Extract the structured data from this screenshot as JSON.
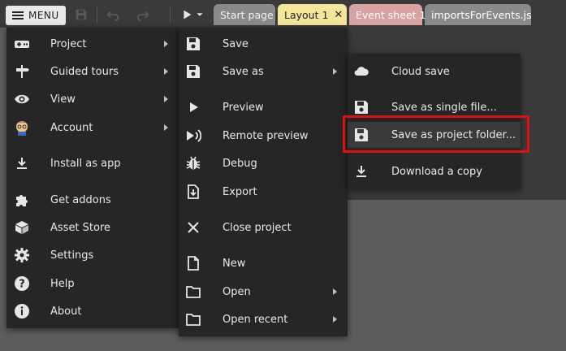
{
  "toolbar": {
    "menu_label": "MENU",
    "tabs": [
      {
        "label": "Start page"
      },
      {
        "label": "Layout 1",
        "close": "✕"
      },
      {
        "label": "Event sheet 1"
      },
      {
        "label": "importsForEvents.js"
      }
    ]
  },
  "main_menu": {
    "items": [
      {
        "label": "Project",
        "icon": "gamepad-icon",
        "submenu": true
      },
      {
        "label": "Guided tours",
        "icon": "signpost-icon",
        "submenu": true
      },
      {
        "label": "View",
        "icon": "eye-icon",
        "submenu": true
      },
      {
        "label": "Account",
        "icon": "avatar-icon",
        "submenu": true
      },
      {
        "label": "Install as app",
        "icon": "download-icon"
      },
      {
        "label": "Get addons",
        "icon": "puzzle-icon"
      },
      {
        "label": "Asset Store",
        "icon": "box-icon"
      },
      {
        "label": "Settings",
        "icon": "gear-icon"
      },
      {
        "label": "Help",
        "icon": "help-icon"
      },
      {
        "label": "About",
        "icon": "info-icon"
      }
    ]
  },
  "project_menu": {
    "items": [
      {
        "label": "Save",
        "icon": "floppy-icon"
      },
      {
        "label": "Save as",
        "icon": "floppy-icon",
        "submenu": true
      },
      {
        "label": "Preview",
        "icon": "play-icon"
      },
      {
        "label": "Remote preview",
        "icon": "remote-preview-icon"
      },
      {
        "label": "Debug",
        "icon": "bug-icon"
      },
      {
        "label": "Export",
        "icon": "export-icon"
      },
      {
        "label": "Close project",
        "icon": "close-icon"
      },
      {
        "label": "New",
        "icon": "file-icon"
      },
      {
        "label": "Open",
        "icon": "folder-icon",
        "submenu": true
      },
      {
        "label": "Open recent",
        "icon": "folder-icon",
        "submenu": true
      }
    ]
  },
  "save_as_menu": {
    "items": [
      {
        "label": "Cloud save",
        "icon": "cloud-icon"
      },
      {
        "label": "Save as single file...",
        "icon": "floppy-icon"
      },
      {
        "label": "Save as project folder...",
        "icon": "floppy-icon",
        "highlighted": true
      },
      {
        "label": "Download a copy",
        "icon": "download-icon"
      }
    ]
  },
  "colors": {
    "highlight_box": "#e01010",
    "layout_tab": "#f4e79b",
    "event_tab": "#d9a2a2"
  }
}
